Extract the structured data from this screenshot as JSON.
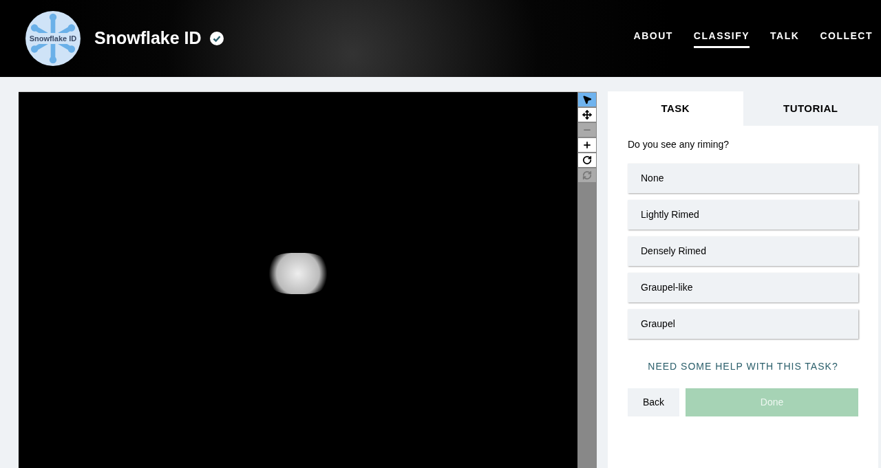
{
  "header": {
    "logo_text": "Snowflake ID",
    "title": "Snowflake ID",
    "verified": true,
    "nav": [
      {
        "label": "ABOUT",
        "selected": false
      },
      {
        "label": "CLASSIFY",
        "selected": true
      },
      {
        "label": "TALK",
        "selected": false
      },
      {
        "label": "COLLECT",
        "selected": false
      }
    ]
  },
  "viewer": {
    "tools": [
      {
        "kind": "pointer",
        "selected": true,
        "disabled": false
      },
      {
        "kind": "move",
        "selected": false,
        "disabled": false
      },
      {
        "kind": "zoom-out",
        "selected": false,
        "disabled": true
      },
      {
        "kind": "zoom-in",
        "selected": false,
        "disabled": false
      },
      {
        "kind": "rotate",
        "selected": false,
        "disabled": false
      },
      {
        "kind": "reset",
        "selected": false,
        "disabled": true
      }
    ]
  },
  "panel": {
    "tabs": [
      {
        "label": "TASK",
        "selected": true
      },
      {
        "label": "TUTORIAL",
        "selected": false
      }
    ],
    "question": "Do you see any riming?",
    "answers": [
      {
        "label": "None",
        "selected": false
      },
      {
        "label": "Lightly Rimed",
        "selected": false
      },
      {
        "label": "Densely Rimed",
        "selected": false
      },
      {
        "label": "Graupel-like",
        "selected": false
      },
      {
        "label": "Graupel",
        "selected": false
      }
    ],
    "help": "NEED SOME HELP WITH THIS TASK?",
    "back": "Back",
    "done": {
      "label": "Done",
      "disabled": true
    }
  }
}
